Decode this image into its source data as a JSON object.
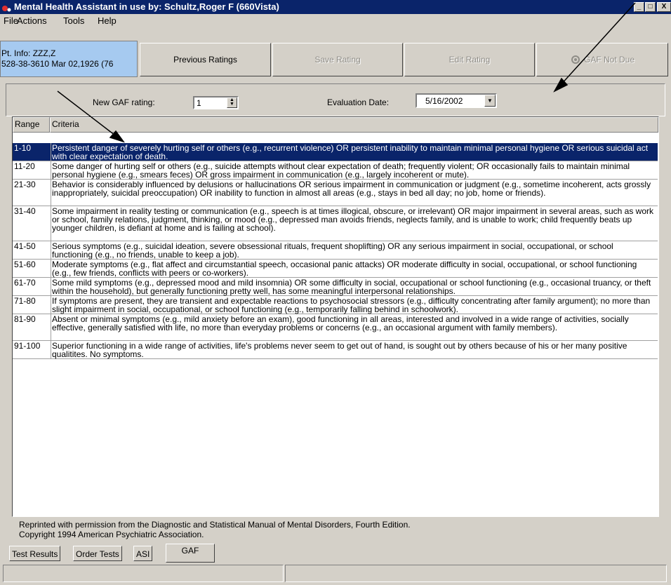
{
  "window": {
    "title": "Mental Health Assistant in use by: Schultz,Roger F  (660Vista)",
    "controls": [
      "_",
      "□",
      "X"
    ]
  },
  "menu": [
    "File",
    "Actions",
    "Tools",
    "Help"
  ],
  "patient": {
    "line1": "Pt. Info: ZZZ,Z",
    "line2": "528-38-3610  Mar 02,1926 (76"
  },
  "toolbar": {
    "previous_ratings": "Previous Ratings",
    "save_rating": "Save Rating",
    "edit_rating": "Edit Rating",
    "gaf_not_due": "GAF Not Due"
  },
  "form": {
    "new_gaf_label": "New GAF rating:",
    "new_gaf_value": "1",
    "eval_date_label": "Evaluation Date:",
    "eval_date_value": "5/16/2002"
  },
  "table": {
    "headers": [
      "Range",
      "Criteria"
    ],
    "rows": [
      {
        "range": "1-10",
        "criteria": "Persistent danger of severely hurting self or others (e.g., recurrent violence) OR persistent inability to maintain minimal personal hygiene OR serious suicidal act with clear expectation of death."
      },
      {
        "range": "11-20",
        "criteria": "Some danger of hurting self or others (e.g., suicide attempts without clear expectation of death; frequently violent; OR occasionally fails to maintain minimal personal hygiene (e.g., smears feces) OR gross impairment in communication (e.g., largely incoherent or mute)."
      },
      {
        "range": "21-30",
        "criteria": "Behavior is considerably influenced by delusions or hallucinations OR serious impairment in communication or judgment (e.g., sometime incoherent, acts grossly inappropriately, suicidal preoccupation) OR inability to function in almost all areas (e.g., stays in bed all day; no job, home or friends)."
      },
      {
        "range": "31-40",
        "criteria": "Some impairment in reality testing or communication (e.g., speech is at times illogical, obscure, or irrelevant) OR major impairment in several areas, such as work or school, family relations, judgment, thinking, or mood (e.g., depressed man avoids friends, neglects family, and is unable to work; child frequently beats up younger children, is defiant at home and is failing at school)."
      },
      {
        "range": "41-50",
        "criteria": "Serious symptoms (e.g., suicidal ideation, severe obsessional rituals, frequent shoplifting) OR any serious impairment in social, occupational, or school functioning (e.g., no friends, unable to keep a job)."
      },
      {
        "range": "51-60",
        "criteria": "Moderate symptoms (e.g., flat affect and circumstantial speech, occasional panic attacks) OR moderate difficulty in social, occupational, or school functioning (e.g., few friends, conflicts with peers or co-workers)."
      },
      {
        "range": "61-70",
        "criteria": "Some mild symptoms (e.g., depressed mood and mild insomnia) OR some difficulty in social, occupational or school functioning (e.g., occasional truancy, or theft within the household), but generally functioning pretty well, has some meaningful interpersonal relationships."
      },
      {
        "range": "71-80",
        "criteria": "If symptoms are present, they are transient and expectable reactions to psychosocial stressors (e.g., difficulty concentrating after family argument); no more than slight impairment in social, occupational, or school functioning (e.g., temporarily falling behind in schoolwork)."
      },
      {
        "range": "81-90",
        "criteria": "Absent or minimal symptoms (e.g., mild anxiety before an exam), good functioning in all areas, interested and involved in a wide range of activities, socially effective, generally satisfied with life, no more than everyday problems or concerns (e.g., an occasional argument with family members)."
      },
      {
        "range": "91-100",
        "criteria": "Superior functioning in a wide range of activities, life's problems never seem to get out of hand, is sought out by others because of his or her many positive qualitites.  No symptoms."
      }
    ]
  },
  "footer": {
    "line1": "Reprinted with permission from the Diagnostic and Statistical Manual of Mental Disorders, Fourth Edition.",
    "line2": "Copyright 1994 American Psychiatric Association."
  },
  "tabs": [
    "Test Results",
    "Order Tests",
    "ASI",
    "GAF"
  ],
  "active_tab": "GAF",
  "colors": {
    "titlebar": "#0a246a",
    "selection": "#0a246a",
    "patient_panel": "#a6caf0",
    "face": "#d4d0c8"
  }
}
